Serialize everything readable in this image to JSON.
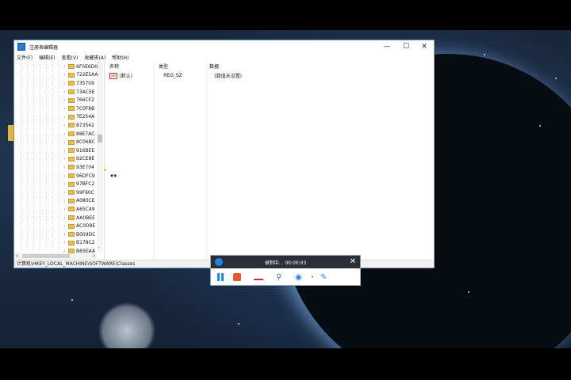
{
  "window": {
    "title": "注册表编辑器",
    "menu": [
      "文件(F)",
      "编辑(E)",
      "查看(V)",
      "收藏夹(A)",
      "帮助(H)"
    ],
    "minimize": "—",
    "maximize": "☐",
    "close": "✕"
  },
  "tree": {
    "keys": [
      "6F0E6D0",
      "722E5AA",
      "735709",
      "73AC5E",
      "766CF2",
      "7C0F8B",
      "7E254A",
      "873542",
      "88E7AC",
      "8C06BC",
      "916BEE",
      "92CE8E",
      "93E704",
      "96DFC9",
      "97BFC2",
      "99F60C",
      "A080CE",
      "A65C49",
      "AA0BEE",
      "AC0D9E",
      "B009DC",
      "B178C2",
      "B65EAA"
    ]
  },
  "values": {
    "headers": {
      "name": "名称",
      "type": "类型",
      "data": "数据"
    },
    "rows": [
      {
        "name": "(默认)",
        "type": "REG_SZ",
        "data": "(数值未设置)",
        "icon_label": "ab"
      }
    ]
  },
  "statusbar": {
    "path": "计算机\\HKEY_LOCAL_MACHINE\\SOFTWARE\\Classes"
  },
  "recorder": {
    "status": "录制中... 00:00:03",
    "close": "✕",
    "dot": "•"
  },
  "colors": {
    "accent": "#1f86e0",
    "record_stop": "#e4572e",
    "folder": "#e8bd52"
  }
}
